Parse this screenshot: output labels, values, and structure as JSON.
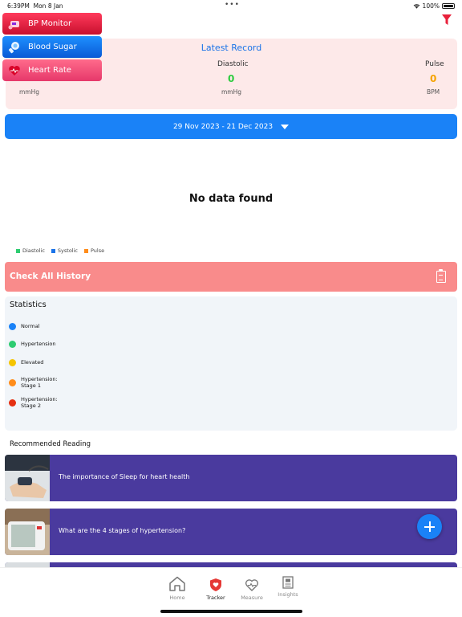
{
  "status_bar": {
    "time": "6:39PM",
    "date": "Mon 8 Jan",
    "dots": "•••",
    "battery": "100%"
  },
  "menu": {
    "items": [
      {
        "label": "BP Monitor"
      },
      {
        "label": "Blood Sugar"
      },
      {
        "label": "Heart Rate"
      }
    ]
  },
  "latest_record": {
    "title": "Latest Record",
    "diastolic_label": "Diastolic",
    "diastolic_value": "0",
    "diastolic_unit": "mmHg",
    "systolic_unit": "mmHg",
    "pulse_label": "Pulse",
    "pulse_value": "0",
    "pulse_unit": "BPM"
  },
  "date_range": {
    "label": "29 Nov 2023 - 21 Dec 2023"
  },
  "empty_state": "No data found",
  "legend": [
    {
      "label": "Diastolic",
      "color": "#2ecc71"
    },
    {
      "label": "Systolic",
      "color": "#1a73e8"
    },
    {
      "label": "Pulse",
      "color": "#ff8c1a"
    }
  ],
  "history": {
    "label": "Check All History"
  },
  "statistics": {
    "title": "Statistics",
    "items": [
      {
        "label": "Normal",
        "color": "#1a82f7"
      },
      {
        "label": "Hypertension",
        "color": "#2ecc71"
      },
      {
        "label": "Elevated",
        "color": "#f5c400"
      },
      {
        "label": "Hypertension:\nStage 1",
        "color": "#ff8c1a"
      },
      {
        "label": "Hypertension:\nStage 2",
        "color": "#e53012"
      }
    ]
  },
  "recommended": {
    "title": "Recommended Reading",
    "articles": [
      {
        "title": "The importance of Sleep for heart health"
      },
      {
        "title": "What are the 4 stages of hypertension?"
      },
      {
        "title": ""
      }
    ]
  },
  "tabs": [
    {
      "label": "Home",
      "icon": "home-icon"
    },
    {
      "label": "Tracker",
      "icon": "shield-heart-icon"
    },
    {
      "label": "Measure",
      "icon": "heart-pulse-icon"
    },
    {
      "label": "Insights",
      "icon": "document-icon"
    }
  ],
  "colors": {
    "accent": "#1a82f7",
    "pink_card": "#fde9e9",
    "history": "#f98b8b",
    "article": "#4a3a9e",
    "active_tab": "#e53935"
  }
}
